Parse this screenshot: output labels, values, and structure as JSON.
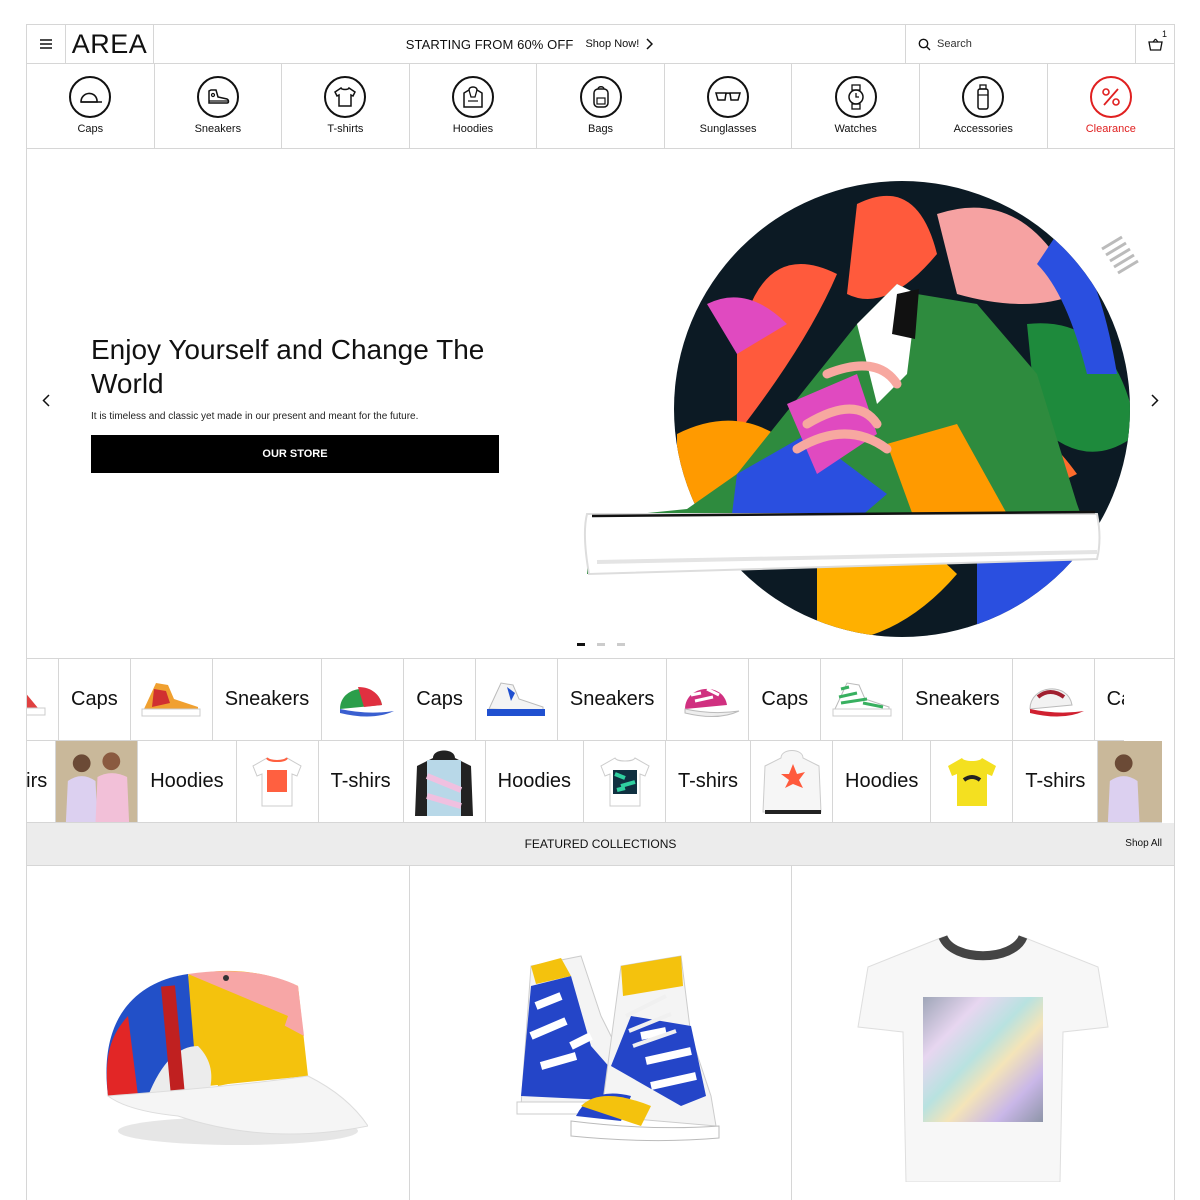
{
  "header": {
    "logo": "AREA",
    "promo": "STARTING FROM 60% OFF",
    "promo_link": "Shop Now!",
    "search_placeholder": "Search",
    "cart_count": "1",
    "icons": {
      "menu": "hamburger-icon",
      "search": "search-icon",
      "cart": "basket-icon",
      "promo_arrow": "chevron-right-icon"
    }
  },
  "categories": [
    {
      "label": "Caps",
      "icon": "cap-icon"
    },
    {
      "label": "Sneakers",
      "icon": "sneaker-icon"
    },
    {
      "label": "T-shirts",
      "icon": "tshirt-icon"
    },
    {
      "label": "Hoodies",
      "icon": "hoodie-icon"
    },
    {
      "label": "Bags",
      "icon": "backpack-icon"
    },
    {
      "label": "Sunglasses",
      "icon": "sunglasses-icon"
    },
    {
      "label": "Watches",
      "icon": "watch-icon"
    },
    {
      "label": "Accessories",
      "icon": "bottle-icon"
    },
    {
      "label": "Clearance",
      "icon": "percent-icon",
      "color": "#e02020"
    }
  ],
  "hero": {
    "title": "Enjoy Yourself and Change The World",
    "subtitle": "It is timeless and classic yet made in our present and meant for the future.",
    "button": "OUR STORE",
    "slides": 3,
    "active_slide": 1
  },
  "marquee_row1": [
    "Caps",
    "Sneakers",
    "Caps",
    "Sneakers",
    "Caps",
    "Sneakers",
    "Caps"
  ],
  "marquee_row2": [
    "hirs",
    "Hoodies",
    "T-shirs",
    "Hoodies",
    "T-shirs",
    "Hoodies",
    "T-shirs"
  ],
  "featured": {
    "title": "FEATURED COLLECTIONS",
    "shop_all": "Shop All"
  },
  "colors": {
    "accent_red": "#e02020",
    "button_bg": "#000000",
    "band_bg": "#ececec"
  }
}
